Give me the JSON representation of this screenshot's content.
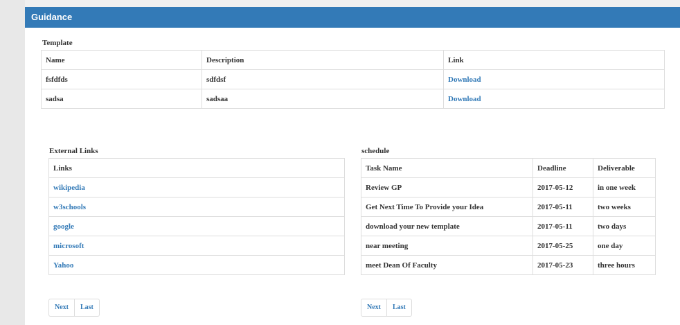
{
  "panel": {
    "title": "Guidance"
  },
  "template": {
    "label": "Template",
    "headers": [
      "Name",
      "Description",
      "Link"
    ],
    "rows": [
      {
        "name": "fsfdfds",
        "description": "sdfdsf",
        "link": "Download"
      },
      {
        "name": "sadsa",
        "description": "sadsaa",
        "link": "Download"
      }
    ]
  },
  "external_links": {
    "label": "External Links",
    "header": "Links",
    "items": [
      "wikipedia",
      "w3schools",
      "google",
      "microsoft",
      "Yahoo"
    ],
    "pager": {
      "next": "Next",
      "last": "Last"
    }
  },
  "schedule": {
    "label": "schedule",
    "headers": [
      "Task Name",
      "Deadline",
      "Deliverable"
    ],
    "rows": [
      {
        "task": "Review GP",
        "deadline": "2017-05-12",
        "deliverable": "in one week"
      },
      {
        "task": "Get Next Time To Provide your Idea",
        "deadline": "2017-05-11",
        "deliverable": "two weeks"
      },
      {
        "task": "download your new template",
        "deadline": "2017-05-11",
        "deliverable": "two days"
      },
      {
        "task": "near meeting",
        "deadline": "2017-05-25",
        "deliverable": "one day"
      },
      {
        "task": "meet Dean Of Faculty",
        "deadline": "2017-05-23",
        "deliverable": "three hours"
      }
    ],
    "pager": {
      "next": "Next",
      "last": "Last"
    }
  },
  "colors": {
    "heading_bg": "#337ab7",
    "link": "#337ab7",
    "border": "#dddddd"
  }
}
